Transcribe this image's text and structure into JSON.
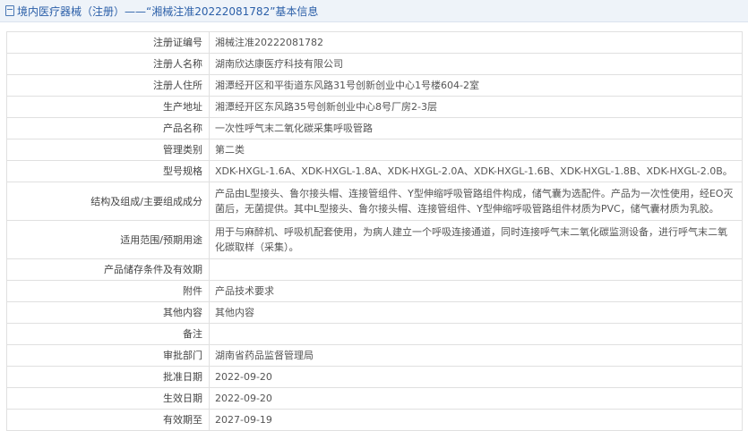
{
  "header": {
    "title": "境内医疗器械（注册）——“湘械注准20222081782”基本信息"
  },
  "rows": [
    {
      "label": "注册证编号",
      "value": "湘械注准20222081782"
    },
    {
      "label": "注册人名称",
      "value": "湖南欣达康医疗科技有限公司"
    },
    {
      "label": "注册人住所",
      "value": "湘潭经开区和平街道东风路31号创新创业中心1号楼604-2室"
    },
    {
      "label": "生产地址",
      "value": "湘潭经开区东风路35号创新创业中心8号厂房2-3层"
    },
    {
      "label": "产品名称",
      "value": "一次性呼气末二氧化碳采集呼吸管路"
    },
    {
      "label": "管理类别",
      "value": "第二类"
    },
    {
      "label": "型号规格",
      "value": "XDK-HXGL-1.6A、XDK-HXGL-1.8A、XDK-HXGL-2.0A、XDK-HXGL-1.6B、XDK-HXGL-1.8B、XDK-HXGL-2.0B。"
    },
    {
      "label": "结构及组成/主要组成成分",
      "value": "产品由L型接头、鲁尔接头帽、连接管组件、Y型伸缩呼吸管路组件构成，储气囊为选配件。产品为一次性使用，经EO灭菌后，无菌提供。其中L型接头、鲁尔接头帽、连接管组件、Y型伸缩呼吸管路组件材质为PVC，储气囊材质为乳胶。"
    },
    {
      "label": "适用范围/预期用途",
      "value": "用于与麻醉机、呼吸机配套使用，为病人建立一个呼吸连接通道，同时连接呼气末二氧化碳监测设备，进行呼气末二氧化碳取样（采集）。"
    },
    {
      "label": "产品储存条件及有效期",
      "value": ""
    },
    {
      "label": "附件",
      "value": "产品技术要求"
    },
    {
      "label": "其他内容",
      "value": "其他内容"
    },
    {
      "label": "备注",
      "value": ""
    },
    {
      "label": "审批部门",
      "value": "湖南省药品监督管理局"
    },
    {
      "label": "批准日期",
      "value": "2022-09-20"
    },
    {
      "label": "生效日期",
      "value": "2022-09-20"
    },
    {
      "label": "有效期至",
      "value": "2027-09-19"
    }
  ]
}
